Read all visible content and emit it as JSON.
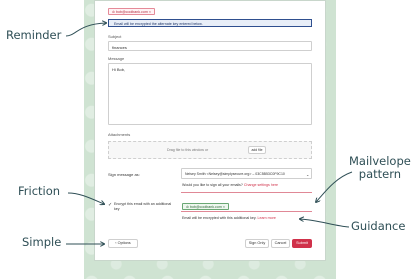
{
  "recipient": {
    "address": "bob@coolbank.com",
    "remove": "×"
  },
  "notice": "Email will be encrypted the alternate key entered below.",
  "subject": {
    "label": "Subject",
    "value": "finances"
  },
  "message": {
    "label": "Message",
    "value": "Hi Bob,"
  },
  "attachments": {
    "label": "Attachments",
    "drop_text": "Drag file to this window or",
    "add_button": "add file"
  },
  "sign": {
    "label": "Sign message as:",
    "selected": "Nelsey Smith <Nelsey@simplysecure.org> – 03C5B53C0F9C10",
    "question": "Would you like to sign all your emails?",
    "change_link": "Change settings here"
  },
  "encrypt": {
    "label": "Encrypt this email with an additional key",
    "checked": true,
    "key_chip": "bob@coolbank.com",
    "guidance": "Email will be encrypted with this additional key.",
    "learn_more": "Learn more"
  },
  "buttons": {
    "options": "Options",
    "sign_only": "Sign Only",
    "cancel": "Cancel",
    "submit": "Submit"
  },
  "annotations": {
    "reminder": "Reminder",
    "friction": "Friction",
    "simple": "Simple",
    "mailvelope_line1": "Mailvelope",
    "mailvelope_line2": "pattern",
    "guidance": "Guidance"
  },
  "colors": {
    "accent": "#d0314a",
    "notice_bg": "#2f4f8f",
    "annot": "#2f4f56",
    "bg_pattern": "#cfe3d2"
  }
}
